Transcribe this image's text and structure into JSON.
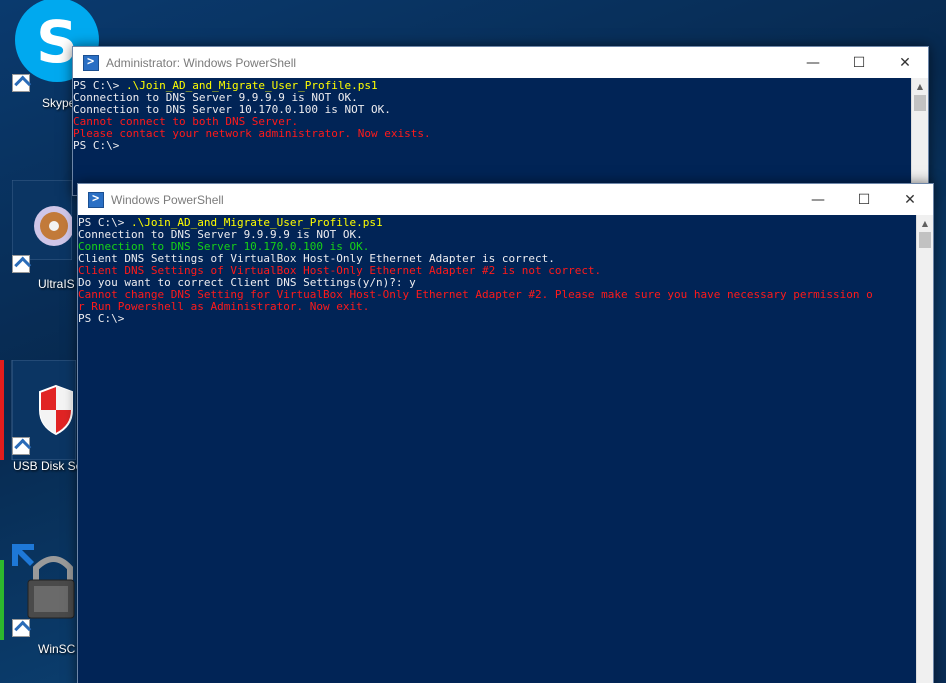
{
  "desktop": {
    "icons": [
      {
        "name": "skype",
        "label": "Skype"
      },
      {
        "name": "ultraiso",
        "label": "UltraIS"
      },
      {
        "name": "usb-disk-security",
        "label": "USB Disk Se"
      },
      {
        "name": "winscp",
        "label": "WinSC"
      }
    ]
  },
  "windows": [
    {
      "title": "Administrator: Windows PowerShell",
      "controls": {
        "minimize": "—",
        "maximize": "☐",
        "close": "✕"
      },
      "lines": [
        {
          "prefix": "PS C:\\> ",
          "text": ".\\Join_AD_and_Migrate_User_Profile.ps1",
          "kind": "cmd"
        },
        {
          "text": "Connection to DNS Server 9.9.9.9 is NOT OK.",
          "kind": "normal"
        },
        {
          "text": "Connection to DNS Server 10.170.0.100 is NOT OK.",
          "kind": "normal"
        },
        {
          "text": "Cannot connect to both DNS Server.",
          "kind": "err"
        },
        {
          "text": "Please contact your network administrator. Now exists.",
          "kind": "err"
        },
        {
          "text": "PS C:\\>",
          "kind": "normal"
        }
      ]
    },
    {
      "title": "Windows PowerShell",
      "controls": {
        "minimize": "—",
        "maximize": "☐",
        "close": "✕"
      },
      "lines": [
        {
          "prefix": "PS C:\\> ",
          "text": ".\\Join_AD_and_Migrate_User_Profile.ps1",
          "kind": "cmd"
        },
        {
          "text": "Connection to DNS Server 9.9.9.9 is NOT OK.",
          "kind": "normal"
        },
        {
          "text": "Connection to DNS Server 10.170.0.100 is OK.",
          "kind": "ok"
        },
        {
          "text": "Client DNS Settings of VirtualBox Host-Only Ethernet Adapter is correct.",
          "kind": "normal"
        },
        {
          "text": "Client DNS Settings of VirtualBox Host-Only Ethernet Adapter #2 is not correct.",
          "kind": "err"
        },
        {
          "text": "Do you want to correct Client DNS Settings(y/n)?: y",
          "kind": "normal"
        },
        {
          "text": "Cannot change DNS Setting for VirtualBox Host-Only Ethernet Adapter #2. Please make sure you have necessary permission o",
          "kind": "err"
        },
        {
          "text": "r Run Powershell as Administrator. Now exit.",
          "kind": "err"
        },
        {
          "text": "PS C:\\>",
          "kind": "normal"
        }
      ]
    }
  ],
  "colors": {
    "console_bg": "#012456",
    "command": "#ffff00",
    "ok": "#17d217",
    "error": "#ff1a1a"
  }
}
